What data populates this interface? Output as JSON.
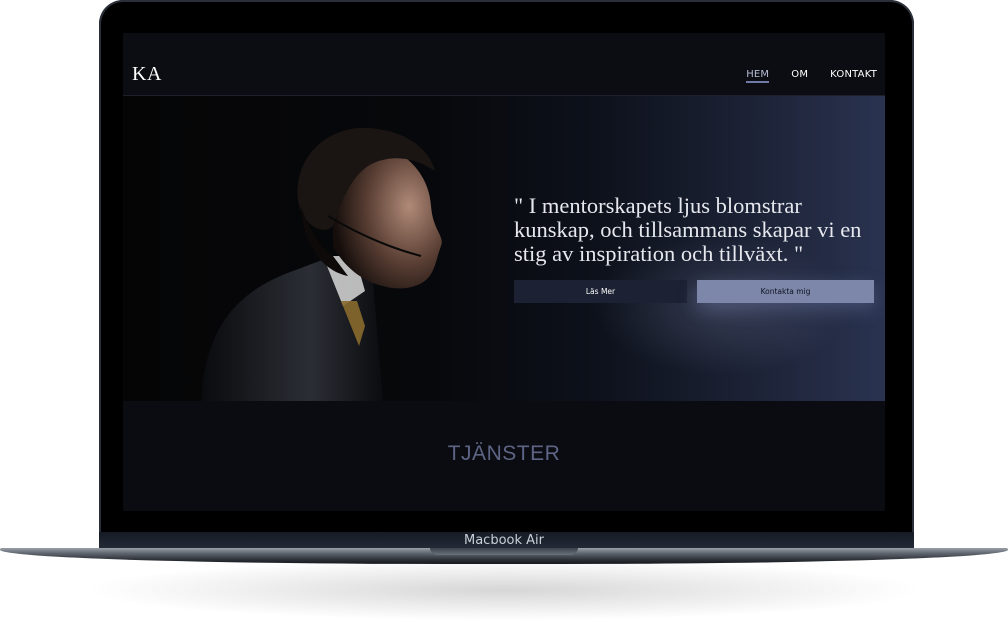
{
  "device": {
    "label": "Macbook Air"
  },
  "site": {
    "logo": "KA",
    "nav": [
      {
        "label": "HEM",
        "active": true
      },
      {
        "label": "OM",
        "active": false
      },
      {
        "label": "KONTAKT",
        "active": false
      }
    ]
  },
  "hero": {
    "quote": "\" I mentorskapets ljus blomstrar kunskap, och tillsammans skapar vi en stig av inspiration och tillväxt. \"",
    "primary_button": "Läs Mer",
    "secondary_button": "Kontakta mig",
    "image": "man-in-suit-profile-portrait"
  },
  "services": {
    "title": "TJÄNSTER"
  },
  "colors": {
    "background": "#0b0d13",
    "accent": "#7d87a9",
    "button_dark": "#1c2233"
  }
}
